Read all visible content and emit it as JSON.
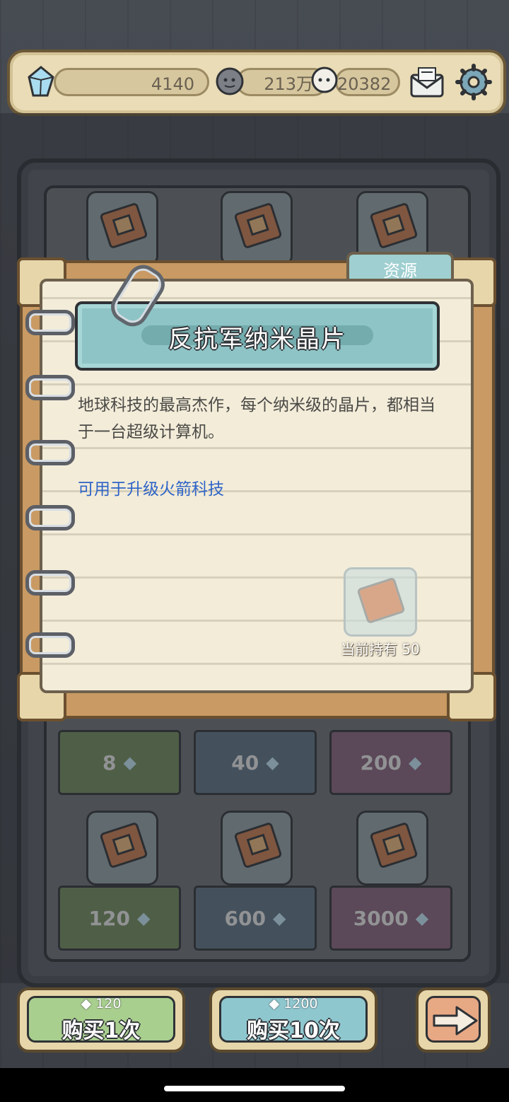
{
  "top_bar": {
    "gems": "4140",
    "coins": "213万",
    "souls": "20382",
    "icons": {
      "gem": "crystal-gem-icon",
      "coin": "coin-face-icon",
      "soul": "ghost-icon",
      "mail": "mail-icon",
      "settings": "gear-icon"
    }
  },
  "shop": {
    "rows": [
      [
        {
          "price": "8",
          "color": "green"
        },
        {
          "price": "40",
          "color": "blue"
        },
        {
          "price": "200",
          "color": "pink"
        }
      ],
      [
        {
          "price": "120",
          "color": "green"
        },
        {
          "price": "600",
          "color": "blue"
        },
        {
          "price": "3000",
          "color": "pink"
        }
      ]
    ]
  },
  "popup": {
    "tab_label": "资源",
    "title": "反抗军纳米晶片",
    "description": "地球科技的最高杰作，每个纳米级的晶片，都相当于一台超级计算机。",
    "usage": "可用于升级火箭科技",
    "owned_label": "当前持有",
    "owned_count": "50"
  },
  "buttons": {
    "buy_one": {
      "cost": "120",
      "label": "购买1次",
      "color": "#a9cf8f"
    },
    "buy_ten": {
      "cost": "1200",
      "label": "购买10次",
      "color": "#8fc7cf"
    },
    "next_icon": "arrow-right-icon"
  }
}
